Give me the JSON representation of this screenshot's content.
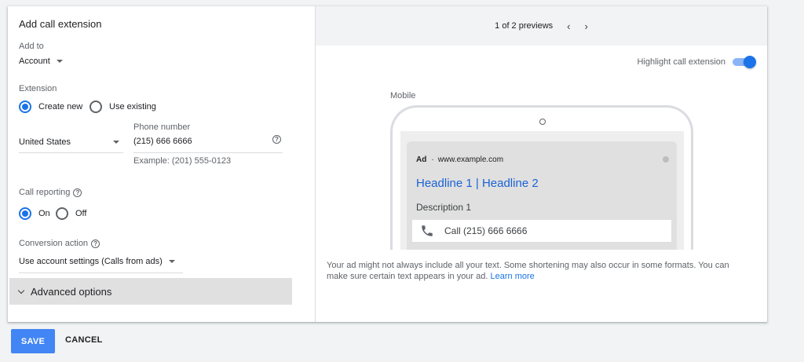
{
  "form": {
    "title": "Add call extension",
    "add_to_label": "Add to",
    "add_to_value": "Account",
    "extension_label": "Extension",
    "create_new_label": "Create new",
    "use_existing_label": "Use existing",
    "country_value": "United States",
    "phone_label": "Phone number",
    "phone_value": "(215) 666 6666",
    "phone_example": "Example: (201) 555-0123",
    "call_reporting_label": "Call reporting",
    "on_label": "On",
    "off_label": "Off",
    "conversion_label": "Conversion action",
    "conversion_value": "Use account settings (Calls from ads)",
    "advanced_label": "Advanced options",
    "help_glyph": "?"
  },
  "preview": {
    "pager_text": "1 of 2 previews",
    "prev_glyph": "‹",
    "next_glyph": "›",
    "highlight_label": "Highlight call extension",
    "highlight_on": true,
    "mobile_label": "Mobile",
    "ad": {
      "badge": "Ad",
      "separator": "·",
      "url": "www.example.com",
      "headline": "Headline 1 | Headline 2",
      "description": "Description 1",
      "call_text": "Call (215) 666 6666"
    },
    "note_text": "Your ad might not always include all your text. Some shortening may also occur in some formats. You can make sure certain text appears in your ad.",
    "learn_more": "Learn more"
  },
  "footer": {
    "save_label": "SAVE",
    "cancel_label": "CANCEL"
  },
  "colors": {
    "accent": "#1a73e8",
    "save_button": "#4285f4",
    "headline_link": "#1a62d6"
  },
  "icons": {
    "help": "help-circle-icon",
    "phone": "phone-icon",
    "prev": "chevron-left-icon",
    "next": "chevron-right-icon",
    "advanced": "chevron-down-icon"
  }
}
